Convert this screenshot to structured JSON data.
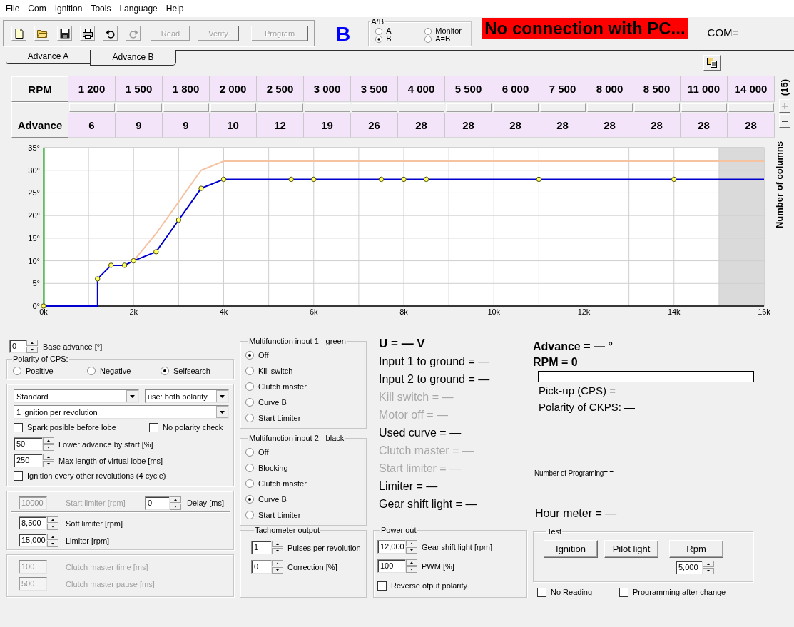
{
  "menu": [
    "File",
    "Com",
    "Ignition",
    "Tools",
    "Language",
    "Help"
  ],
  "toolbar": {
    "tools": [
      {
        "kind": "new",
        "disabled": false
      },
      {
        "kind": "open",
        "disabled": false
      },
      {
        "kind": "save",
        "disabled": false
      },
      {
        "kind": "print",
        "disabled": false
      },
      {
        "kind": "undo",
        "disabled": false
      },
      {
        "kind": "redo",
        "disabled": true
      }
    ],
    "buttons": [
      {
        "label": "Read",
        "disabled": true
      },
      {
        "label": "Verify",
        "disabled": true
      },
      {
        "label": "Program",
        "disabled": true
      }
    ]
  },
  "active_curve": "B",
  "curve_select": {
    "title": "A/B",
    "options": [
      {
        "label": "A",
        "selected": false
      },
      {
        "label": "Monitor",
        "selected": false
      },
      {
        "label": "B",
        "selected": true
      },
      {
        "label": "A=B",
        "selected": false
      }
    ]
  },
  "connection_status": "No connection with PC...",
  "com_port": "COM=",
  "tabs": [
    {
      "label": "Advance A",
      "selected": false
    },
    {
      "label": "Advance B",
      "selected": true
    }
  ],
  "table": {
    "rpm_header": "RPM",
    "advance_header": "Advance",
    "rpm": [
      "1 200",
      "1 500",
      "1 800",
      "2 000",
      "2 500",
      "3 000",
      "3 500",
      "4 000",
      "5 500",
      "6 000",
      "7 500",
      "8 000",
      "8 500",
      "11 000",
      "14 000"
    ],
    "advance": [
      "6",
      "9",
      "9",
      "10",
      "12",
      "19",
      "26",
      "28",
      "28",
      "28",
      "28",
      "28",
      "28",
      "28",
      "28"
    ]
  },
  "columns": {
    "count": "(15)",
    "label": "Number of columns",
    "buttons": [
      {
        "kind": "add",
        "disabled": true
      },
      {
        "kind": "remove",
        "disabled": false
      }
    ]
  },
  "chart": {
    "chart_data": {
      "type": "line",
      "grid": true,
      "x": [
        0,
        1200,
        1200,
        1500,
        1800,
        2000,
        2500,
        3000,
        3500,
        4000,
        5500,
        6000,
        7500,
        8000,
        8500,
        11000,
        14000,
        16000
      ],
      "series": [
        {
          "color": "#f5c2a2",
          "values": [
            null,
            null,
            null,
            null,
            null,
            10,
            16,
            23,
            30,
            32,
            32,
            32,
            32,
            32,
            32,
            32,
            32,
            32
          ]
        },
        {
          "color": "#0000cc",
          "marker": "circle",
          "values": [
            0,
            0,
            6,
            9,
            9,
            10,
            12,
            19,
            26,
            28,
            28,
            28,
            28,
            28,
            28,
            28,
            28,
            28
          ]
        }
      ],
      "xlim": [
        0,
        16000
      ],
      "ylim": [
        0,
        35
      ],
      "xticks": [
        {
          "value": 0,
          "label": "0k"
        },
        {
          "value": 2000,
          "label": "2k"
        },
        {
          "value": 4000,
          "label": "4k"
        },
        {
          "value": 6000,
          "label": "6k"
        },
        {
          "value": 8000,
          "label": "8k"
        },
        {
          "value": 10000,
          "label": "10k"
        },
        {
          "value": 12000,
          "label": "12k"
        },
        {
          "value": 14000,
          "label": "14k"
        },
        {
          "value": 16000,
          "label": "16k"
        }
      ],
      "yticks": [
        {
          "value": 0,
          "label": "0°"
        },
        {
          "value": 5,
          "label": "5°"
        },
        {
          "value": 10,
          "label": "10°"
        },
        {
          "value": 15,
          "label": "15°"
        },
        {
          "value": 20,
          "label": "20°"
        },
        {
          "value": 25,
          "label": "25°"
        },
        {
          "value": 30,
          "label": "30°"
        },
        {
          "value": 35,
          "label": "35°"
        }
      ],
      "bands": [
        {
          "axis": "x",
          "from": 15000,
          "to": 16000,
          "color": "#dadada"
        }
      ]
    }
  },
  "base_advance": {
    "value": "0",
    "label": "Base advance [°]",
    "disabled": false
  },
  "cps_polarity": {
    "title": "Polarity of CPS:",
    "options": [
      {
        "label": "Positive",
        "selected": false
      },
      {
        "label": "Negative",
        "selected": false
      },
      {
        "label": "Selfsearch",
        "selected": true
      }
    ]
  },
  "ignition": {
    "dropdowns": [
      "Standard",
      "use: both polarity",
      "1 ignition per revolution"
    ],
    "checks": [
      {
        "label": "Spark posible before lobe",
        "checked": false
      },
      {
        "label": "No polarity check",
        "checked": false
      }
    ],
    "fields": [
      {
        "value": "50",
        "label": "Lower advance by start [%]",
        "disabled": false
      },
      {
        "value": "250",
        "label": "Max length of virtual lobe [ms]",
        "disabled": false
      }
    ],
    "four_cycle": {
      "label": "Ignition every other revolutions (4 cycle)",
      "checked": false
    }
  },
  "limiter": {
    "start": {
      "value": "10000",
      "label": "Start limiter [rpm]",
      "disabled": true
    },
    "delay": {
      "value": "0",
      "label": "Delay [ms]",
      "disabled": false
    },
    "fields": [
      {
        "value": "8,500",
        "label": "Soft limiter [rpm]",
        "disabled": false
      },
      {
        "value": "15,000",
        "label": "Limiter [rpm]",
        "disabled": false
      }
    ]
  },
  "clutch": [
    {
      "value": "100",
      "label": "Clutch master time [ms]",
      "disabled": true
    },
    {
      "value": "500",
      "label": "Clutch master pause [ms]",
      "disabled": true
    }
  ],
  "multifunction": [
    {
      "title": "Multifunction input 1 - green",
      "options": [
        {
          "label": "Off",
          "selected": true
        },
        {
          "label": "Kill switch",
          "selected": false
        },
        {
          "label": "Clutch master",
          "selected": false
        },
        {
          "label": "Curve B",
          "selected": false
        },
        {
          "label": "Start Limiter",
          "selected": false
        }
      ]
    },
    {
      "title": "Multifunction input 2 - black",
      "options": [
        {
          "label": "Off",
          "selected": false
        },
        {
          "label": "Blocking",
          "selected": false
        },
        {
          "label": "Clutch master",
          "selected": false
        },
        {
          "label": "Curve B",
          "selected": true
        },
        {
          "label": "Start Limiter",
          "selected": false
        }
      ]
    }
  ],
  "tachometer": {
    "title": "Tachometer output",
    "fields": [
      {
        "value": "1",
        "label": "Pulses per revolution",
        "disabled": false
      },
      {
        "value": "0",
        "label": "Correction [%]",
        "disabled": false
      }
    ]
  },
  "readings": {
    "voltage": "U = — V",
    "lines": [
      {
        "text": "Input 1 to ground = —",
        "disabled": false
      },
      {
        "text": "Input 2 to ground = —",
        "disabled": false
      },
      {
        "text": "Kill switch = —",
        "disabled": true
      },
      {
        "text": "Motor off = —",
        "disabled": true
      },
      {
        "text": "Used curve = —",
        "disabled": false
      },
      {
        "text": "Clutch master = —",
        "disabled": true
      },
      {
        "text": "Start limiter = —",
        "disabled": true
      },
      {
        "text": "Limiter = —",
        "disabled": false
      },
      {
        "text": "Gear shift light = —",
        "disabled": false
      }
    ]
  },
  "power_out": {
    "title": "Power out",
    "fields": [
      {
        "value": "12,000",
        "label": "Gear shift light [rpm]",
        "disabled": false
      },
      {
        "value": "100",
        "label": "PWM [%]",
        "disabled": false
      }
    ],
    "reverse": {
      "label": "Reverse otput polarity",
      "checked": false
    }
  },
  "monitor": {
    "advance": "Advance = — °",
    "rpm": "RPM = 0",
    "lines": [
      "Pick-up (CPS) = —",
      "Polarity of CKPS: —"
    ],
    "programming_count": "Number of Programing= = ---",
    "hour_meter": "Hour meter = —"
  },
  "test": {
    "title": "Test",
    "buttons": [
      "Ignition",
      "Pilot light",
      "Rpm"
    ],
    "rpm": {
      "value": "5,000",
      "disabled": false
    }
  },
  "options": [
    {
      "label": "No Reading",
      "checked": false
    },
    {
      "label": "Programming after change",
      "checked": false
    }
  ]
}
